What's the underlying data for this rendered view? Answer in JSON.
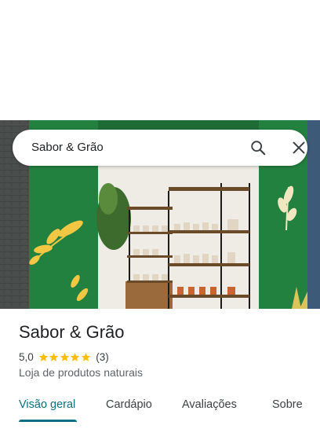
{
  "search": {
    "query": "Sabor & Grão"
  },
  "place": {
    "name": "Sabor & Grão",
    "rating": "5,0",
    "stars": 5,
    "review_count": "(3)",
    "category": "Loja de produtos naturais"
  },
  "tabs": [
    {
      "label": "Visão geral",
      "active": true
    },
    {
      "label": "Cardápio",
      "active": false
    },
    {
      "label": "Avaliações",
      "active": false
    },
    {
      "label": "Sobre",
      "active": false
    }
  ],
  "colors": {
    "accent": "#0b6e81",
    "star": "#fbbc04",
    "store_green": "#1f7a3a"
  }
}
